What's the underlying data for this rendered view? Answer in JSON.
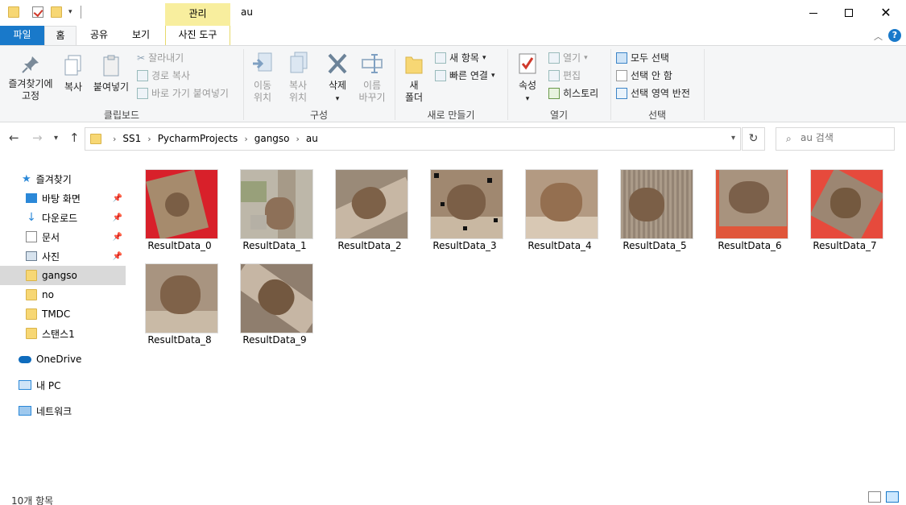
{
  "titlebar": {
    "context_tab_label": "관리",
    "title": "au"
  },
  "tabs": {
    "file": "파일",
    "home": "홈",
    "share": "공유",
    "view": "보기",
    "photo_tools": "사진 도구"
  },
  "ribbon": {
    "clipboard": {
      "label": "클립보드",
      "pin_quick": "즐겨찾기에\n고정",
      "copy": "복사",
      "paste": "붙여넣기",
      "cut": "잘라내기",
      "copy_path": "경로 복사",
      "paste_shortcut": "바로 가기 붙여넣기"
    },
    "organize": {
      "label": "구성",
      "move_to": "이동\n위치",
      "copy_to": "복사\n위치",
      "delete": "삭제",
      "rename": "이름\n바꾸기"
    },
    "new": {
      "label": "새로 만들기",
      "new_folder": "새\n폴더",
      "new_item": "새 항목",
      "easy_access": "빠른 연결"
    },
    "open": {
      "label": "열기",
      "properties": "속성",
      "open": "열기",
      "edit": "편집",
      "history": "히스토리"
    },
    "select": {
      "label": "선택",
      "select_all": "모두 선택",
      "select_none": "선택 안 함",
      "invert": "선택 영역 반전"
    }
  },
  "address": {
    "crumbs": [
      "SS1",
      "PycharmProjects",
      "gangso",
      "au"
    ],
    "search_placeholder": "au 검색"
  },
  "sidebar": {
    "quick_access": "즐겨찾기",
    "items": [
      {
        "label": "바탕 화면",
        "pinned": true,
        "icon": "desktop-icon"
      },
      {
        "label": "다운로드",
        "pinned": true,
        "icon": "download-icon"
      },
      {
        "label": "문서",
        "pinned": true,
        "icon": "document-icon"
      },
      {
        "label": "사진",
        "pinned": true,
        "icon": "pictures-icon"
      },
      {
        "label": "gangso",
        "pinned": false,
        "icon": "folder-icon",
        "selected": true
      },
      {
        "label": "no",
        "pinned": false,
        "icon": "folder-icon"
      },
      {
        "label": "TMDC",
        "pinned": false,
        "icon": "folder-icon"
      },
      {
        "label": "스탠스1",
        "pinned": false,
        "icon": "folder-icon"
      }
    ],
    "onedrive": "OneDrive",
    "this_pc": "내 PC",
    "network": "네트워크"
  },
  "files": [
    {
      "name": "ResultData_0",
      "bg": "#d8202a"
    },
    {
      "name": "ResultData_1",
      "bg": "#bdb7a9"
    },
    {
      "name": "ResultData_2",
      "bg": "#9a8a78"
    },
    {
      "name": "ResultData_3",
      "bg": "#a08870"
    },
    {
      "name": "ResultData_4",
      "bg": "#b39a82"
    },
    {
      "name": "ResultData_5",
      "bg": "#9c8c7c"
    },
    {
      "name": "ResultData_6",
      "bg": "#e0563a"
    },
    {
      "name": "ResultData_7",
      "bg": "#e64a3c"
    },
    {
      "name": "ResultData_8",
      "bg": "#a89480"
    },
    {
      "name": "ResultData_9",
      "bg": "#8f7e6e"
    }
  ],
  "status": {
    "count": "10개 항목"
  },
  "colors": {
    "accent": "#1979ca",
    "context_tab": "#f8ee9e",
    "folder": "#f7d774"
  }
}
